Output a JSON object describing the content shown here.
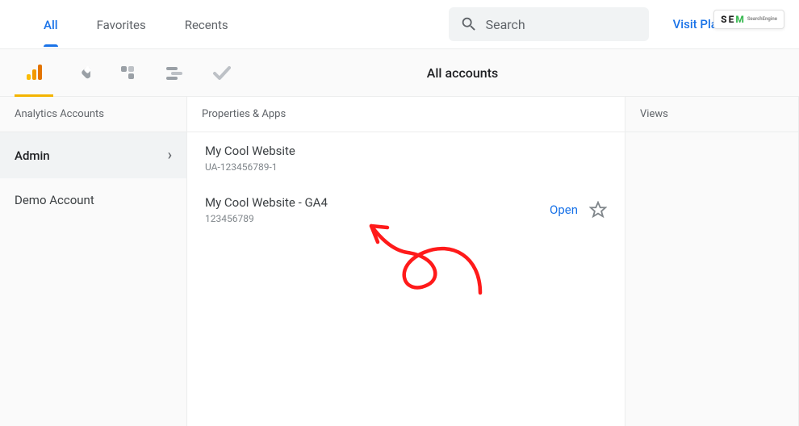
{
  "topbar": {
    "tabs": [
      {
        "label": "All",
        "active": true
      },
      {
        "label": "Favorites",
        "active": false
      },
      {
        "label": "Recents",
        "active": false
      }
    ],
    "search_placeholder": "Search",
    "visit_platform": "Visit Platform Home",
    "badge_text": "SearchEngine"
  },
  "product_row": {
    "heading": "All accounts",
    "products": [
      {
        "name": "analytics",
        "active": true
      },
      {
        "name": "tag-manager",
        "active": false
      },
      {
        "name": "optimize",
        "active": false
      },
      {
        "name": "data-studio",
        "active": false
      },
      {
        "name": "surveys",
        "active": false
      }
    ]
  },
  "columns": {
    "accounts": {
      "header": "Analytics Accounts",
      "items": [
        {
          "label": "Admin",
          "selected": true
        },
        {
          "label": "Demo Account",
          "selected": false
        }
      ]
    },
    "properties": {
      "header": "Properties & Apps",
      "items": [
        {
          "name": "My Cool Website",
          "id": "UA-123456789-1",
          "open": false
        },
        {
          "name": "My Cool Website - GA4",
          "id": "123456789",
          "open": true,
          "open_label": "Open"
        }
      ]
    },
    "views": {
      "header": "Views"
    }
  }
}
